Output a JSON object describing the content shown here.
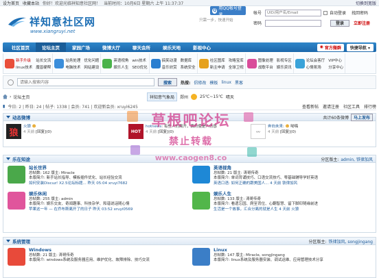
{
  "topbar": {
    "items": [
      "设为首页",
      "收藏本站",
      "你好！欢迎光临祥知意社区网！",
      "当前时间：10月6日 星期六 上午 11:37:37"
    ],
    "right": "切换到宽版"
  },
  "logo": {
    "title": "祥知意社区网",
    "url": "www.xiangruyi.net"
  },
  "qq": {
    "login": "用QQ帐号登录",
    "sub": "只需一步，快速开始"
  },
  "login": {
    "account_label": "帐号",
    "account_placeholder": "UID/用户名/Email",
    "remember": "自动登录",
    "forgot": "找回密码",
    "password_label": "密码",
    "login_btn": "登录",
    "register": "立即注册"
  },
  "nav": {
    "items": [
      "社区首页",
      "论坛主页",
      "家园广场",
      "微博大厅",
      "聊天会所",
      "娱乐天地",
      "影视中心"
    ],
    "fav": "官方微群",
    "quick": "快捷导航"
  },
  "subnav": [
    {
      "color": "#e94f3a",
      "links": [
        "新手升级",
        "站长交流",
        "linux技术",
        "魔兽硬帮"
      ]
    },
    {
      "color": "#3b8edb",
      "links": [
        "站务处理",
        "优化问题",
        "电脑技术",
        "网站建设"
      ]
    },
    {
      "color": "#4ab34a",
      "links": [
        "英语视角",
        "win技术",
        "娱乐人生",
        "SEO优化"
      ]
    },
    {
      "color": "#2b7fd0",
      "links": [
        "搞笑动漫",
        "数据库",
        "音乐欣赏",
        "系统安全"
      ]
    },
    {
      "color": "#e6a21c",
      "links": [
        "社区图库",
        "攻略宝库",
        "新主申请",
        "全球卫视"
      ]
    },
    {
      "color": "#d94c9a",
      "links": [
        "图像处理",
        "影视专区",
        "战歌平台",
        "娱乐资讯"
      ]
    },
    {
      "color": "#3aa3d9",
      "links": [
        "论坛会客厅",
        "VIP中心",
        "心情氛场",
        "分享中心"
      ]
    }
  ],
  "search": {
    "placeholder": "请输入搜索内容",
    "btn": "搜索",
    "hot_label": "热搜:",
    "hot": [
      "侣修改",
      "模板",
      "linux",
      "黑客"
    ]
  },
  "crumb": {
    "home": "论坛主页"
  },
  "weather": {
    "station": "祥知意气象局",
    "city": "郑州",
    "temp": "25℃~15℃",
    "desc": "晴天"
  },
  "stats": {
    "text": "今日: 2 | 昨日: 24 | 帖子: 1338 | 会员: 741 | 欢迎新会员: xruyi6245",
    "links": [
      "查看新帖",
      "邀请注册",
      "社区工具",
      "排行榜"
    ]
  },
  "dynamic": {
    "title": "动态微博",
    "right": "共计60条微博",
    "post_btn": "马上发布",
    "items": [
      {
        "name": "火狼",
        "text": "",
        "time": "4 天前",
        "tag": "[回复](0)"
      },
      {
        "name": "hotnews",
        "text": "有些人的离开，真的使是人伤感",
        "time": "4 天前",
        "tag": "[回复](0)"
      },
      {
        "name": "奔向未来",
        "text": "呦嗨",
        "time": "4 天前",
        "tag": "[回复](0)"
      }
    ]
  },
  "fun": {
    "title": "乐在知途",
    "right_label": "分区版主:",
    "right_names": "admin, 铁律加风",
    "forums": [
      {
        "name": "站长世界",
        "stats": "总帖数: 162  版主: Miracle",
        "intro": "本版简介: 新手站长指导、模板插件优化、站长经验交流",
        "latest": "如何安装Discuz! X2.5论坛标题...  昨天 05:04  xruyi7682",
        "color": "#4aa84a"
      },
      {
        "name": "英语视角",
        "stats": "总帖数: 21  版主: 涛哥传奇",
        "intro": "本版简介: 单词背诵技巧、口语交流技巧、零基础辅导学好英语",
        "latest": "英语口语: 如何正确的跟美国人...  4 天前  铁律加风",
        "color": "#1e88d6"
      },
      {
        "name": "娱乐休闲",
        "stats": "总帖数: 255  版主: admin",
        "intro": "本版简介: 娱乐交友、奇闻趣事、科技杂学、和谐说话随心情",
        "latest": "苹果这一年 — 在乔布斯离开了的日子  昨天 03:52  xruyi0569",
        "color": "#e0559c"
      },
      {
        "name": "娱乐人生",
        "stats": "总帖数: 133  版主: 涛哥传奇",
        "intro": "本版简介: 看遗忘园、爬至背位、心翻智慧、留下脚印随缘前进",
        "latest": "生活是一个故事，汇合分离的就是人生  4 天前  火狼",
        "color": "#52b64a"
      }
    ]
  },
  "sys": {
    "title": "系统管理",
    "right_label": "分区版主:",
    "right_names": "铁律加风, songjingang",
    "forums": [
      {
        "name": "Windows",
        "stats": "总帖数: 21  版主: 涛哥传奇",
        "intro": "本版简介: windows系统及服务器应用、维护优化、故障排除、技巧交流",
        "color": "#e84a3a"
      },
      {
        "name": "Linux",
        "stats": "总帖数: 147  版主: Miracle, songjingang",
        "intro": "本版简介: linux系统及服务器安装、调试运维、应用管理技术分享",
        "color": "#3b7ec7"
      }
    ]
  },
  "watermark": {
    "line1": "草根吧论坛",
    "line2": "禁止转载",
    "line3": "www.caogen8.co"
  }
}
